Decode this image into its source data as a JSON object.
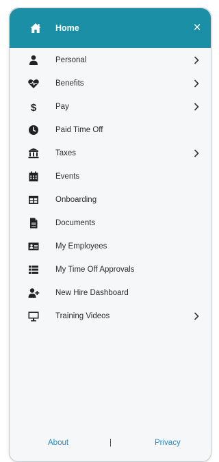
{
  "header": {
    "title": "Home",
    "close_label": "×"
  },
  "colors": {
    "header_bg": "#1b8fa6",
    "link": "#2b8cc4",
    "icon": "#222222"
  },
  "menu": {
    "items": [
      {
        "label": "Personal",
        "icon": "user-icon",
        "has_submenu": true
      },
      {
        "label": "Benefits",
        "icon": "heartbeat-icon",
        "has_submenu": true
      },
      {
        "label": "Pay",
        "icon": "dollar-icon",
        "has_submenu": true
      },
      {
        "label": "Paid Time Off",
        "icon": "clock-icon",
        "has_submenu": false
      },
      {
        "label": "Taxes",
        "icon": "bank-icon",
        "has_submenu": true
      },
      {
        "label": "Events",
        "icon": "calendar-icon",
        "has_submenu": false
      },
      {
        "label": "Onboarding",
        "icon": "table-icon",
        "has_submenu": false
      },
      {
        "label": "Documents",
        "icon": "file-icon",
        "has_submenu": false
      },
      {
        "label": "My Employees",
        "icon": "id-card-icon",
        "has_submenu": false
      },
      {
        "label": "My Time Off Approvals",
        "icon": "list-icon",
        "has_submenu": false
      },
      {
        "label": "New Hire Dashboard",
        "icon": "user-plus-icon",
        "has_submenu": false
      },
      {
        "label": "Training Videos",
        "icon": "monitor-icon",
        "has_submenu": true
      }
    ]
  },
  "footer": {
    "about": "About",
    "separator": "|",
    "privacy": "Privacy"
  }
}
